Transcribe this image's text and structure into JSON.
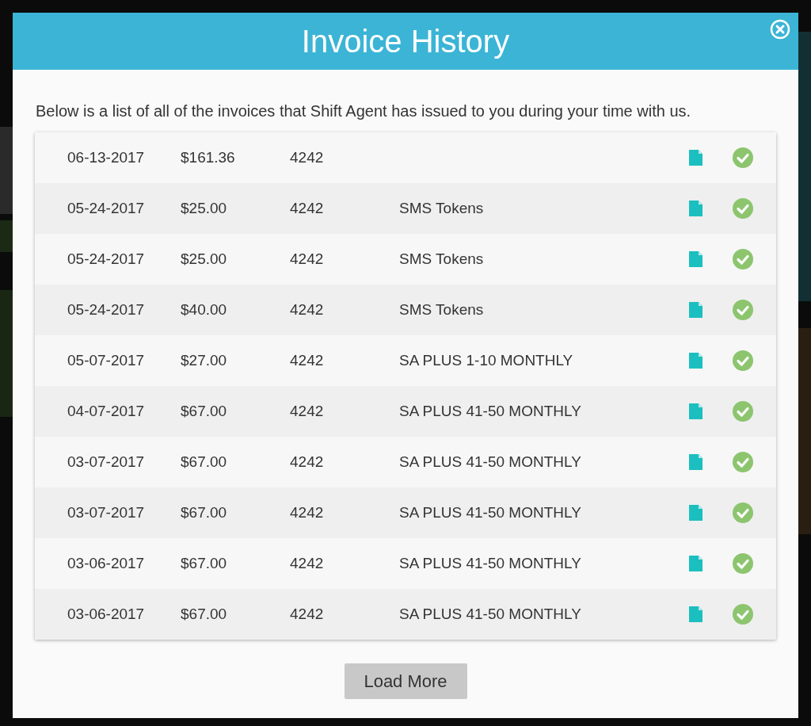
{
  "modal": {
    "title": "Invoice History",
    "intro": "Below is a list of all of the invoices that Shift Agent has issued to you during your time with us.",
    "invoices": [
      {
        "date": "06-13-2017",
        "amount": "$161.36",
        "number": "4242",
        "paid": true
      },
      {
        "date": "05-24-2017",
        "amount": "$25.00",
        "number": "4242",
        "description": "SMS Tokens",
        "paid": true
      },
      {
        "date": "05-24-2017",
        "amount": "$25.00",
        "number": "4242",
        "description": "SMS Tokens",
        "paid": true
      },
      {
        "date": "05-24-2017",
        "amount": "$40.00",
        "number": "4242",
        "description": "SMS Tokens",
        "paid": true
      },
      {
        "date": "05-07-2017",
        "amount": "$27.00",
        "number": "4242",
        "description": "SA PLUS 1-10 MONTHLY",
        "paid": true
      },
      {
        "date": "04-07-2017",
        "amount": "$67.00",
        "number": "4242",
        "description": "SA PLUS 41-50 MONTHLY",
        "paid": true
      },
      {
        "date": "03-07-2017",
        "amount": "$67.00",
        "number": "4242",
        "description": "SA PLUS 41-50 MONTHLY",
        "paid": true
      },
      {
        "date": "03-07-2017",
        "amount": "$67.00",
        "number": "4242",
        "description": "SA PLUS 41-50 MONTHLY",
        "paid": true
      },
      {
        "date": "03-06-2017",
        "amount": "$67.00",
        "number": "4242",
        "description": "SA PLUS 41-50 MONTHLY",
        "paid": true
      },
      {
        "date": "03-06-2017",
        "amount": "$67.00",
        "number": "4242",
        "description": "SA PLUS 41-50 MONTHLY",
        "paid": true
      }
    ],
    "load_more": "Load More"
  }
}
